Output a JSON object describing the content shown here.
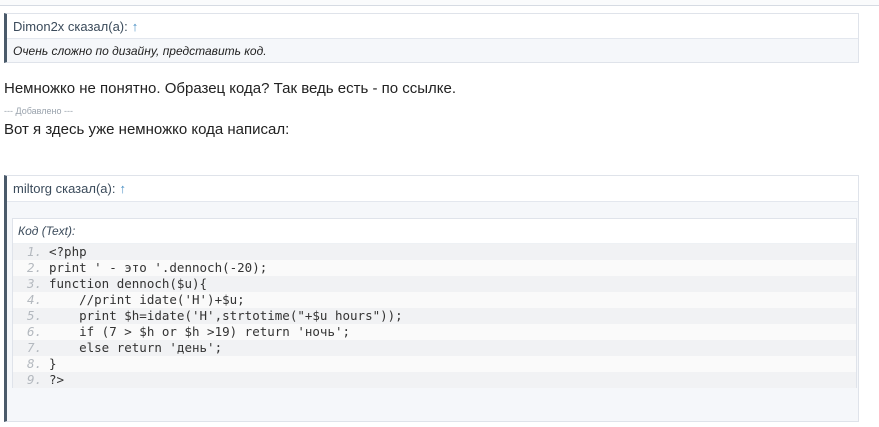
{
  "quote1": {
    "author": "Dimon2x сказал(а):",
    "arrow": "↑",
    "text": "Очень сложно по дизайну, представить код."
  },
  "message": {
    "line1": "Немножко не понятно. Образец кода? Так ведь есть - по ссылке.",
    "added_label": "--- Добавлено ---",
    "line2": "Вот я здесь уже немножко кода написал:"
  },
  "quote2": {
    "author": "miltorg сказал(а):",
    "arrow": "↑",
    "code": {
      "title": "Код (Text):",
      "lines": [
        {
          "n": "1.",
          "src": "<?php"
        },
        {
          "n": "2.",
          "src": "print ' - это '.dennoch(-20);"
        },
        {
          "n": "3.",
          "src": "function dennoch($u){"
        },
        {
          "n": "4.",
          "src": "    //print idate('H')+$u;"
        },
        {
          "n": "5.",
          "src": "    print $h=idate('H',strtotime(\"+$u hours\"));"
        },
        {
          "n": "6.",
          "src": "    if (7 > $h or $h >19) return 'ночь';"
        },
        {
          "n": "7.",
          "src": "    else return 'день';"
        },
        {
          "n": "8.",
          "src": "}"
        },
        {
          "n": "9.",
          "src": "?>"
        }
      ]
    }
  }
}
